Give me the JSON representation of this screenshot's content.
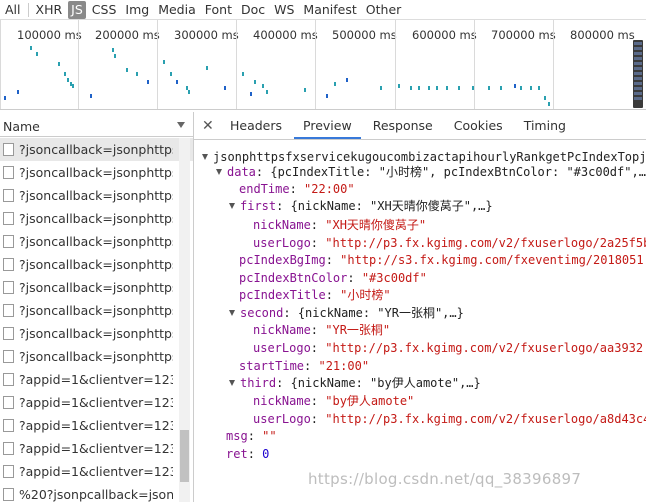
{
  "filters": [
    "All",
    "XHR",
    "JS",
    "CSS",
    "Img",
    "Media",
    "Font",
    "Doc",
    "WS",
    "Manifest",
    "Other"
  ],
  "active_filter": "JS",
  "timeline": {
    "ticks": [
      "100000 ms",
      "200000 ms",
      "300000 ms",
      "400000 ms",
      "500000 ms",
      "600000 ms",
      "700000 ms",
      "800000 ms"
    ]
  },
  "name_column": {
    "header": "Name"
  },
  "requests": [
    "?jsoncallback=jsonphttpsf...",
    "?jsoncallback=jsonphttpsf...",
    "?jsoncallback=jsonphttpsf...",
    "?jsoncallback=jsonphttpsf...",
    "?jsoncallback=jsonphttpsf...",
    "?jsoncallback=jsonphttpsf...",
    "?jsoncallback=jsonphttpsf...",
    "?jsoncallback=jsonphttpsf...",
    "?jsoncallback=jsonphttpsf...",
    "?jsoncallback=jsonphttpsf...",
    "?appid=1&clientver=1234...",
    "?appid=1&clientver=1234...",
    "?appid=1&clientver=1234...",
    "?appid=1&clientver=1234...",
    "?appid=1&clientver=1234...",
    "%20?jsonpcallback=jsonp..."
  ],
  "detail_tabs": [
    "Headers",
    "Preview",
    "Response",
    "Cookies",
    "Timing"
  ],
  "active_tab": "Preview",
  "preview": {
    "root": "jsonphttpsfxservicekugoucombizactapihourlyRankgetPcIndexTopj",
    "data_summary": "{pcIndexTitle: \"小时榜\", pcIndexBtnColor: \"#3c00df\",…}",
    "endTime": "\"22:00\"",
    "first_summary": "{nickName: \"XH天晴你傻莴子\",…}",
    "first_nickName": "\"XH天晴你傻莴子\"",
    "first_userLogo": "\"http://p3.fx.kgimg.com/v2/fxuserlogo/2a25f5b",
    "pcIndexBgImg": "\"http://s3.fx.kgimg.com/fxeventimg/2018051",
    "pcIndexBtnColor": "\"#3c00df\"",
    "pcIndexTitle": "\"小时榜\"",
    "second_summary": "{nickName: \"YR一张桐\",…}",
    "second_nickName": "\"YR一张桐\"",
    "second_userLogo": "\"http://p3.fx.kgimg.com/v2/fxuserlogo/aa3932",
    "startTime": "\"21:00\"",
    "third_summary": "{nickName: \"by伊人amote\",…}",
    "third_nickName": "\"by伊人amote\"",
    "third_userLogo": "\"http://p3.fx.kgimg.com/v2/fxuserlogo/a8d43c4",
    "msg": "\"\"",
    "ret": "0"
  },
  "watermark": "https://blog.csdn.net/qq_38396897"
}
